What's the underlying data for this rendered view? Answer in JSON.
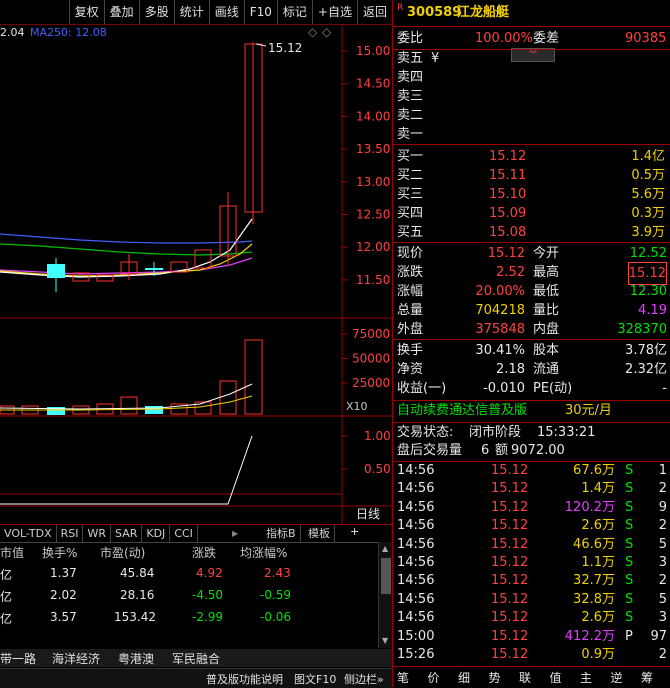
{
  "toolbar": {
    "items": [
      "复权",
      "叠加",
      "多股",
      "统计",
      "画线",
      "F10",
      "标记",
      "+自选",
      "返回"
    ]
  },
  "chart": {
    "ma_label_prefix": "2.04",
    "ma250_label": "MA250: 12.08",
    "high_label": "15.12",
    "price_ticks": [
      "15.00",
      "14.50",
      "14.00",
      "13.50",
      "13.00",
      "12.50",
      "12.00",
      "11.50"
    ],
    "vol_ticks": [
      "75000",
      "50000",
      "25000"
    ],
    "vol_unit": "X10",
    "ind_ticks": [
      "1.00",
      "0.50"
    ],
    "period_label": "日线",
    "colors": {
      "up": "#ff3030",
      "down": "#40ffff",
      "ma1": "#ffffff",
      "ma2": "#f0d000",
      "ma3": "#e040ff",
      "ma4": "#00d000",
      "ma5": "#4060ff"
    }
  },
  "ind_tabs": [
    "VOL-TDX",
    "RSI",
    "WR",
    "SAR",
    "KDJ",
    "CCI"
  ],
  "ind_right": {
    "indicator_b": "指标B",
    "template": "模板",
    "add": "+"
  },
  "table": {
    "headers": [
      "市值",
      "换手%",
      "市盈(动)",
      "涨跌",
      "均涨幅%"
    ],
    "rows": [
      {
        "c0": "亿",
        "c1": "1.37",
        "c2": "45.84",
        "c3": "4.92",
        "c4": "2.43"
      },
      {
        "c0": "亿",
        "c1": "2.02",
        "c2": "28.16",
        "c3": "-4.50",
        "c4": "-0.59"
      },
      {
        "c0": "亿",
        "c1": "3.57",
        "c2": "153.42",
        "c3": "-2.99",
        "c4": "-0.06"
      }
    ]
  },
  "sector_tabs": [
    "带一路",
    "海洋经济",
    "粤港澳",
    "军民融合"
  ],
  "bottom_bar": [
    "普及版功能说明",
    "图文F10",
    "侧边栏»"
  ],
  "quote": {
    "r_badge": "R",
    "code": "300589",
    "name": "江龙船艇",
    "weibi_label": "委比",
    "weibi_value": "100.00%",
    "weicha_label": "委差",
    "weicha_value": "90385",
    "sell_labels": [
      "卖五",
      "卖四",
      "卖三",
      "卖二",
      "卖一"
    ],
    "sell5_extra": "¥",
    "buys": [
      {
        "label": "买一",
        "price": "15.12",
        "vol": "1.4亿"
      },
      {
        "label": "买二",
        "price": "15.11",
        "vol": "0.5万"
      },
      {
        "label": "买三",
        "price": "15.10",
        "vol": "5.6万"
      },
      {
        "label": "买四",
        "price": "15.09",
        "vol": "0.3万"
      },
      {
        "label": "买五",
        "price": "15.08",
        "vol": "3.9万"
      }
    ],
    "stats": [
      {
        "l1": "现价",
        "v1": "15.12",
        "l2": "今开",
        "v2": "12.52"
      },
      {
        "l1": "涨跌",
        "v1": "2.52",
        "l2": "最高",
        "v2": "15.12"
      },
      {
        "l1": "涨幅",
        "v1": "20.00%",
        "l2": "最低",
        "v2": "12.30"
      },
      {
        "l1": "总量",
        "v1": "704218",
        "l2": "量比",
        "v2": "4.19"
      },
      {
        "l1": "外盘",
        "v1": "375848",
        "l2": "内盘",
        "v2": "328370"
      }
    ],
    "stats2": [
      {
        "l1": "换手",
        "v1": "30.41%",
        "l2": "股本",
        "v2": "3.78亿"
      },
      {
        "l1": "净资",
        "v1": "2.18",
        "l2": "流通",
        "v2": "2.32亿"
      },
      {
        "l1": "收益(一)",
        "v1": "-0.010",
        "l2": "PE(动)",
        "v2": "-"
      }
    ],
    "promo_text": "自动续费通达信普及版",
    "promo_price": "30元/月",
    "trade_state_label": "交易状态:",
    "trade_state_value": "闭市阶段",
    "trade_state_time": "15:33:21",
    "after_label": "盘后交易量",
    "after_vol": "6",
    "after_amt_label": "额",
    "after_amt": "9072.00"
  },
  "ticks": [
    {
      "t": "14:56",
      "p": "15.12",
      "v": "67.6万",
      "s": "S",
      "n": "1"
    },
    {
      "t": "14:56",
      "p": "15.12",
      "v": "1.4万",
      "s": "S",
      "n": "2"
    },
    {
      "t": "14:56",
      "p": "15.12",
      "v": "120.2万",
      "s": "S",
      "n": "9"
    },
    {
      "t": "14:56",
      "p": "15.12",
      "v": "2.6万",
      "s": "S",
      "n": "2"
    },
    {
      "t": "14:56",
      "p": "15.12",
      "v": "46.6万",
      "s": "S",
      "n": "5"
    },
    {
      "t": "14:56",
      "p": "15.12",
      "v": "1.1万",
      "s": "S",
      "n": "3"
    },
    {
      "t": "14:56",
      "p": "15.12",
      "v": "32.7万",
      "s": "S",
      "n": "2"
    },
    {
      "t": "14:56",
      "p": "15.12",
      "v": "32.8万",
      "s": "S",
      "n": "5"
    },
    {
      "t": "14:56",
      "p": "15.12",
      "v": "2.6万",
      "s": "S",
      "n": "3"
    },
    {
      "t": "15:00",
      "p": "15.12",
      "v": "412.2万",
      "s": "P",
      "n": "97"
    },
    {
      "t": "15:26",
      "p": "15.12",
      "v": "0.9万",
      "s": "",
      "n": "2"
    }
  ],
  "right_bottom_tabs": [
    "笔",
    "价",
    "细",
    "势",
    "联",
    "值",
    "主",
    "逆",
    "筹"
  ]
}
